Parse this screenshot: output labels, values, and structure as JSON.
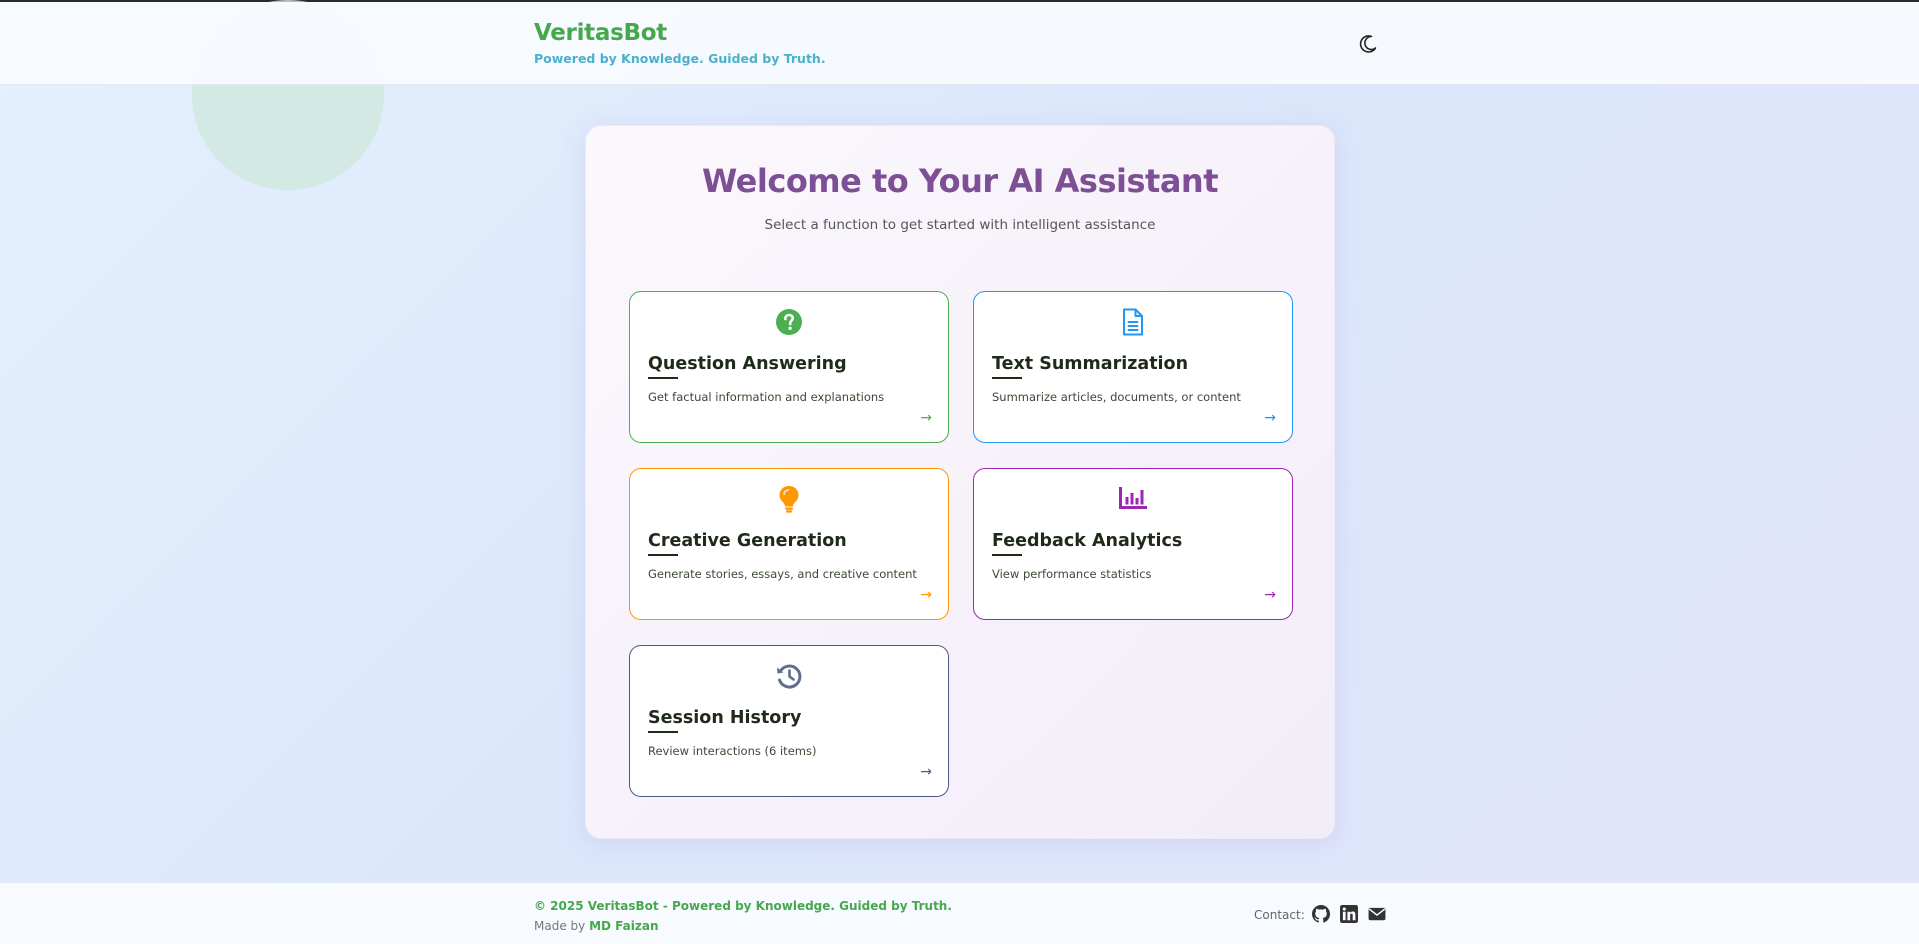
{
  "header": {
    "brand_name": "VeritasBot",
    "tagline": "Powered by Knowledge. Guided by Truth.",
    "theme_toggle_icon": "moon-icon"
  },
  "main": {
    "title": "Welcome to Your AI Assistant",
    "subtitle": "Select a function to get started with intelligent assistance",
    "cards": [
      {
        "title": "Question Answering",
        "description": "Get factual information and explanations",
        "icon": "question-circle-icon",
        "color": "#4caf50",
        "arrow": "→"
      },
      {
        "title": "Text Summarization",
        "description": "Summarize articles, documents, or content",
        "icon": "document-icon",
        "color": "#2196f3",
        "arrow": "→"
      },
      {
        "title": "Creative Generation",
        "description": "Generate stories, essays, and creative content",
        "icon": "lightbulb-icon",
        "color": "#ff9800",
        "arrow": "→"
      },
      {
        "title": "Feedback Analytics",
        "description": "View performance statistics",
        "icon": "bar-chart-icon",
        "color": "#9c27b0",
        "arrow": "→"
      },
      {
        "title": "Session History",
        "description": "Review interactions (6 items)",
        "icon": "history-icon",
        "color": "#4b5a8a",
        "arrow": "→"
      }
    ]
  },
  "footer": {
    "copyright": "© 2025 VeritasBot - Powered by Knowledge. Guided by Truth.",
    "made_by_prefix": "Made by",
    "author": "MD Faizan",
    "contact_label": "Contact:",
    "social_icons": [
      "github-icon",
      "linkedin-icon",
      "envelope-icon"
    ]
  },
  "colors": {
    "brand": "#46a84c",
    "tagline": "#4ab0cc",
    "title": "#7d4f94"
  }
}
